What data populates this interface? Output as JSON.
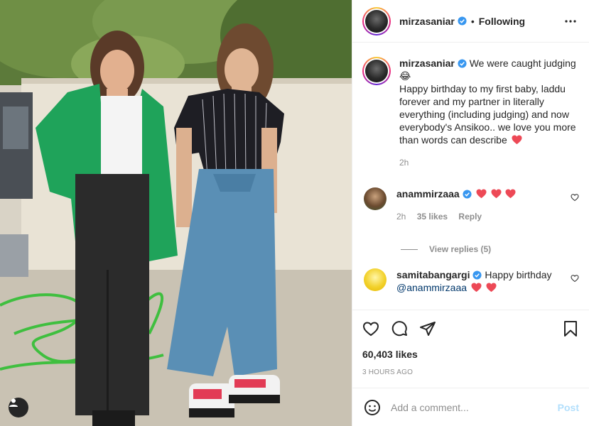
{
  "post": {
    "author": "mirzasaniar",
    "follow_state": "Following",
    "separator": "•",
    "caption_lines": [
      "We were caught judging 😂",
      "Happy birthday to my first baby, laddu forever and my partner in literally everything (including judging) and now everybody's Ansikoo.. we love you more than words can describe"
    ],
    "caption_time": "2h"
  },
  "comments": [
    {
      "user": "anammirzaaa",
      "text": "",
      "hearts": 3,
      "time": "2h",
      "likes": "35 likes",
      "reply": "Reply",
      "view_replies": "View replies (5)"
    },
    {
      "user": "samitabangargi",
      "text": "Happy birthday",
      "mention": "@anammirzaaa",
      "hearts": 2
    }
  ],
  "stats": {
    "likes": "60,403 likes",
    "posted": "3 HOURS AGO"
  },
  "composer": {
    "placeholder": "Add a comment...",
    "post_label": "Post"
  },
  "colors": {
    "verified": "#3897f0",
    "heart": "#ed4956",
    "link": "#00376b",
    "muted": "#8e8e8e"
  }
}
